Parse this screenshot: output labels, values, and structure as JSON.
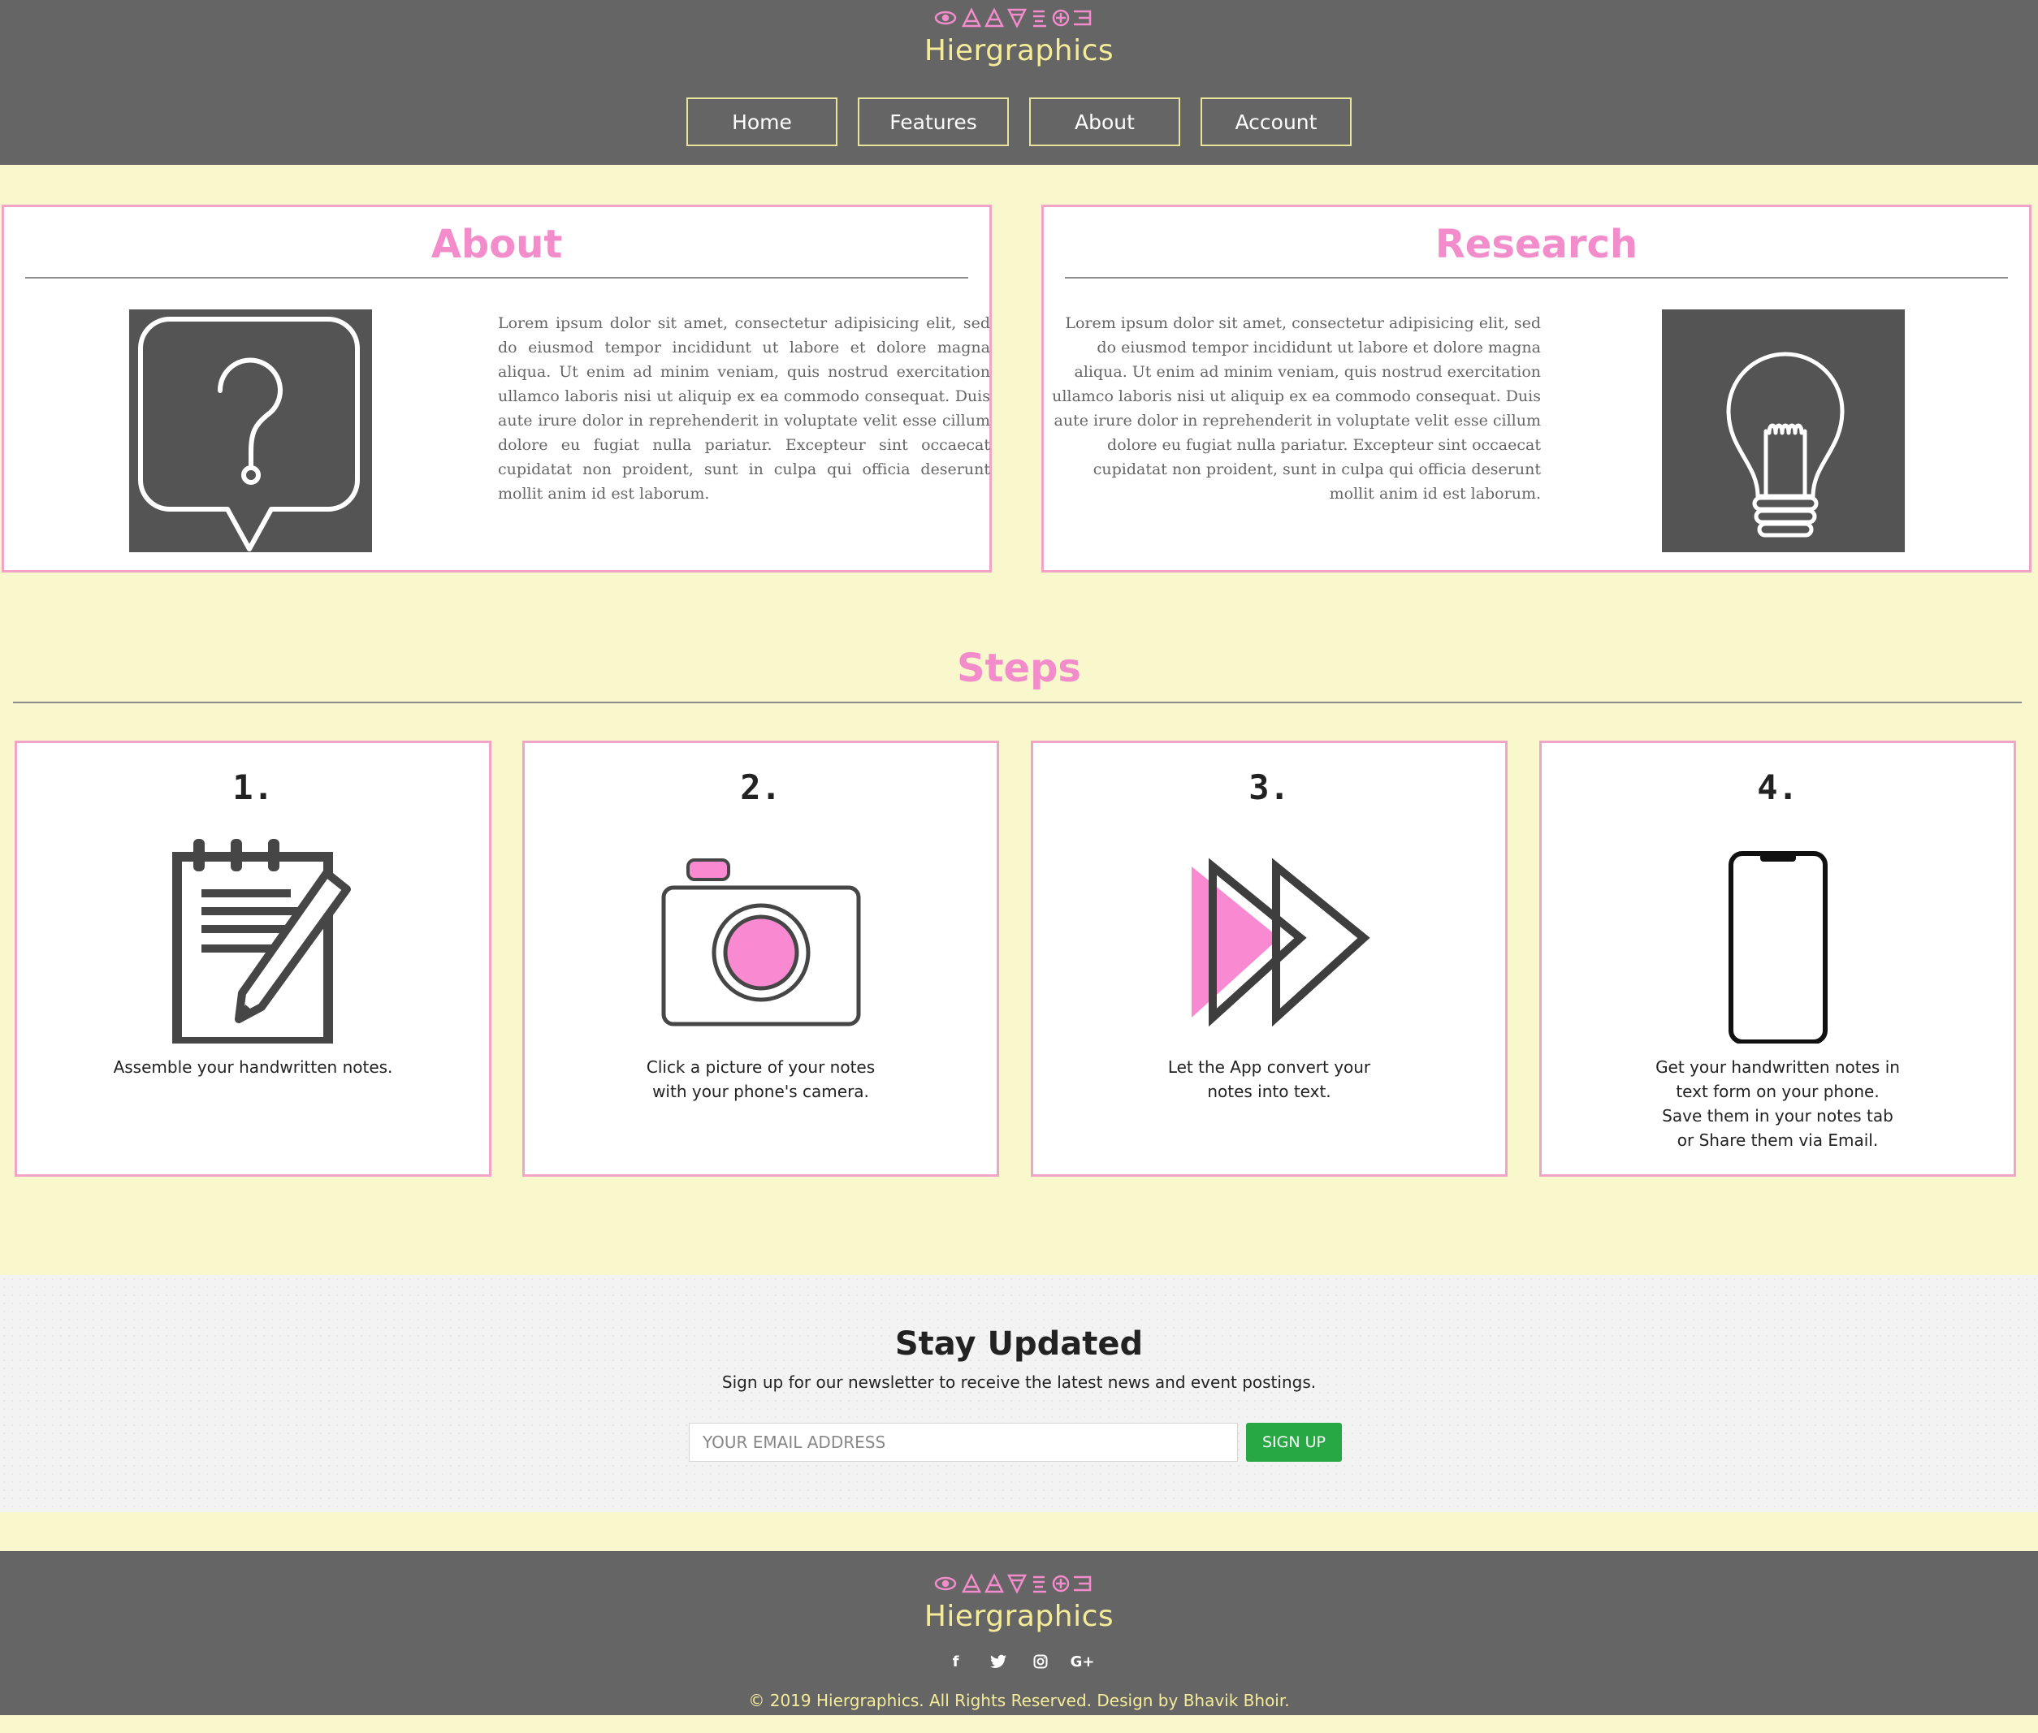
{
  "header": {
    "brand": "Hiergraphics",
    "nav": [
      {
        "label": "Home"
      },
      {
        "label": "Features"
      },
      {
        "label": "About"
      },
      {
        "label": "Account"
      }
    ]
  },
  "about": {
    "title": "About",
    "text": "Lorem ipsum dolor sit amet, consectetur adipisicing elit, sed do eiusmod tempor incididunt ut labore et dolore magna aliqua. Ut enim ad minim veniam, quis nostrud exercitation ullamco laboris nisi ut aliquip ex ea commodo consequat. Duis aute irure dolor in reprehenderit in voluptate velit esse cillum dolore eu fugiat nulla pariatur. Excepteur sint occaecat cupidatat non proident, sunt in culpa qui officia deserunt mollit anim id est laborum.",
    "icon": "question-bubble-icon"
  },
  "research": {
    "title": "Research",
    "text": "Lorem ipsum dolor sit amet, consectetur adipisicing elit, sed do eiusmod tempor incididunt ut labore et dolore magna aliqua. Ut enim ad minim veniam, quis nostrud exercitation ullamco laboris nisi ut aliquip ex ea commodo consequat. Duis aute irure dolor in reprehenderit in voluptate velit esse cillum dolore eu fugiat nulla pariatur. Excepteur sint occaecat cupidatat non proident, sunt in culpa qui officia deserunt mollit anim id est laborum.",
    "icon": "lightbulb-icon"
  },
  "steps": {
    "title": "Steps",
    "items": [
      {
        "num": "1.",
        "desc": "Assemble your handwritten notes.",
        "icon": "notepad-pencil-icon"
      },
      {
        "num": "2.",
        "desc": "Click a picture of your notes\nwith your phone's camera.",
        "icon": "camera-icon"
      },
      {
        "num": "3.",
        "desc": "Let the App convert your\nnotes into text.",
        "icon": "fast-forward-icon"
      },
      {
        "num": "4.",
        "desc": "Get your handwritten notes in\ntext form on your phone.\nSave them in your notes tab\nor Share them via Email.",
        "icon": "smartphone-icon"
      }
    ]
  },
  "newsletter": {
    "title": "Stay Updated",
    "subtitle": "Sign up for our newsletter to receive the latest news and event postings.",
    "placeholder": "YOUR EMAIL ADDRESS",
    "button": "SIGN UP"
  },
  "footer": {
    "brand": "Hiergraphics",
    "socials": [
      {
        "icon": "facebook-icon",
        "glyph": "f"
      },
      {
        "icon": "twitter-icon",
        "glyph": "t"
      },
      {
        "icon": "instagram-icon",
        "glyph": "◎"
      },
      {
        "icon": "google-plus-icon",
        "glyph": "G+"
      }
    ],
    "copyright": "© 2019 Hiergraphics. All Rights Reserved. Design by Bhavik Bhoir."
  },
  "colors": {
    "header_bg": "#656565",
    "page_bg": "#f9f8cc",
    "accent_pink": "#f38ccb",
    "brand_yellow": "#f4ec9a",
    "signup_green": "#28a745"
  }
}
